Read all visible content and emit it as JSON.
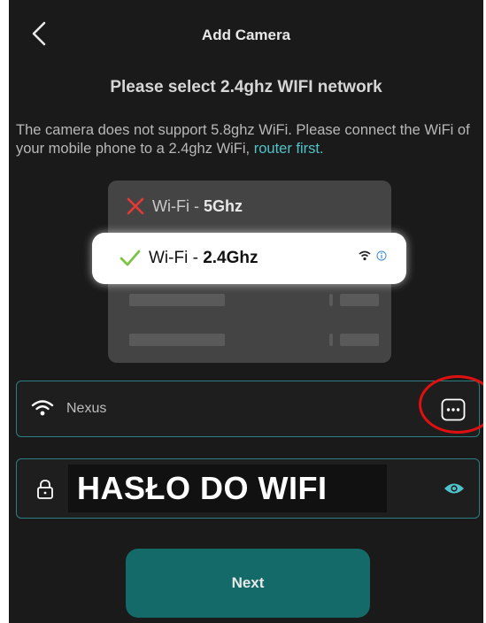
{
  "header": {
    "title": "Add Camera"
  },
  "heading": "Please select 2.4ghz WIFI network",
  "description": {
    "text": "The camera does not support 5.8ghz WiFi. Please connect the WiFi of your mobile phone to a 2.4ghz WiFi, ",
    "link": "router first."
  },
  "illustration": {
    "option_5ghz": {
      "prefix": "Wi-Fi - ",
      "band": "5Ghz",
      "status": "invalid"
    },
    "option_24ghz": {
      "prefix": "Wi-Fi - ",
      "band": "2.4Ghz",
      "status": "valid"
    }
  },
  "ssid_field": {
    "value": "Nexus",
    "icon": "wifi-icon",
    "action_icon": "more-icon"
  },
  "password_field": {
    "value": "HASŁO DO WIFI",
    "icon": "lock-icon",
    "toggle_icon": "eye-icon"
  },
  "next_button": {
    "label": "Next"
  },
  "colors": {
    "accent": "#4fc3c9",
    "button": "#136a69",
    "border": "#2e7d80",
    "annotation": "#e01010"
  }
}
